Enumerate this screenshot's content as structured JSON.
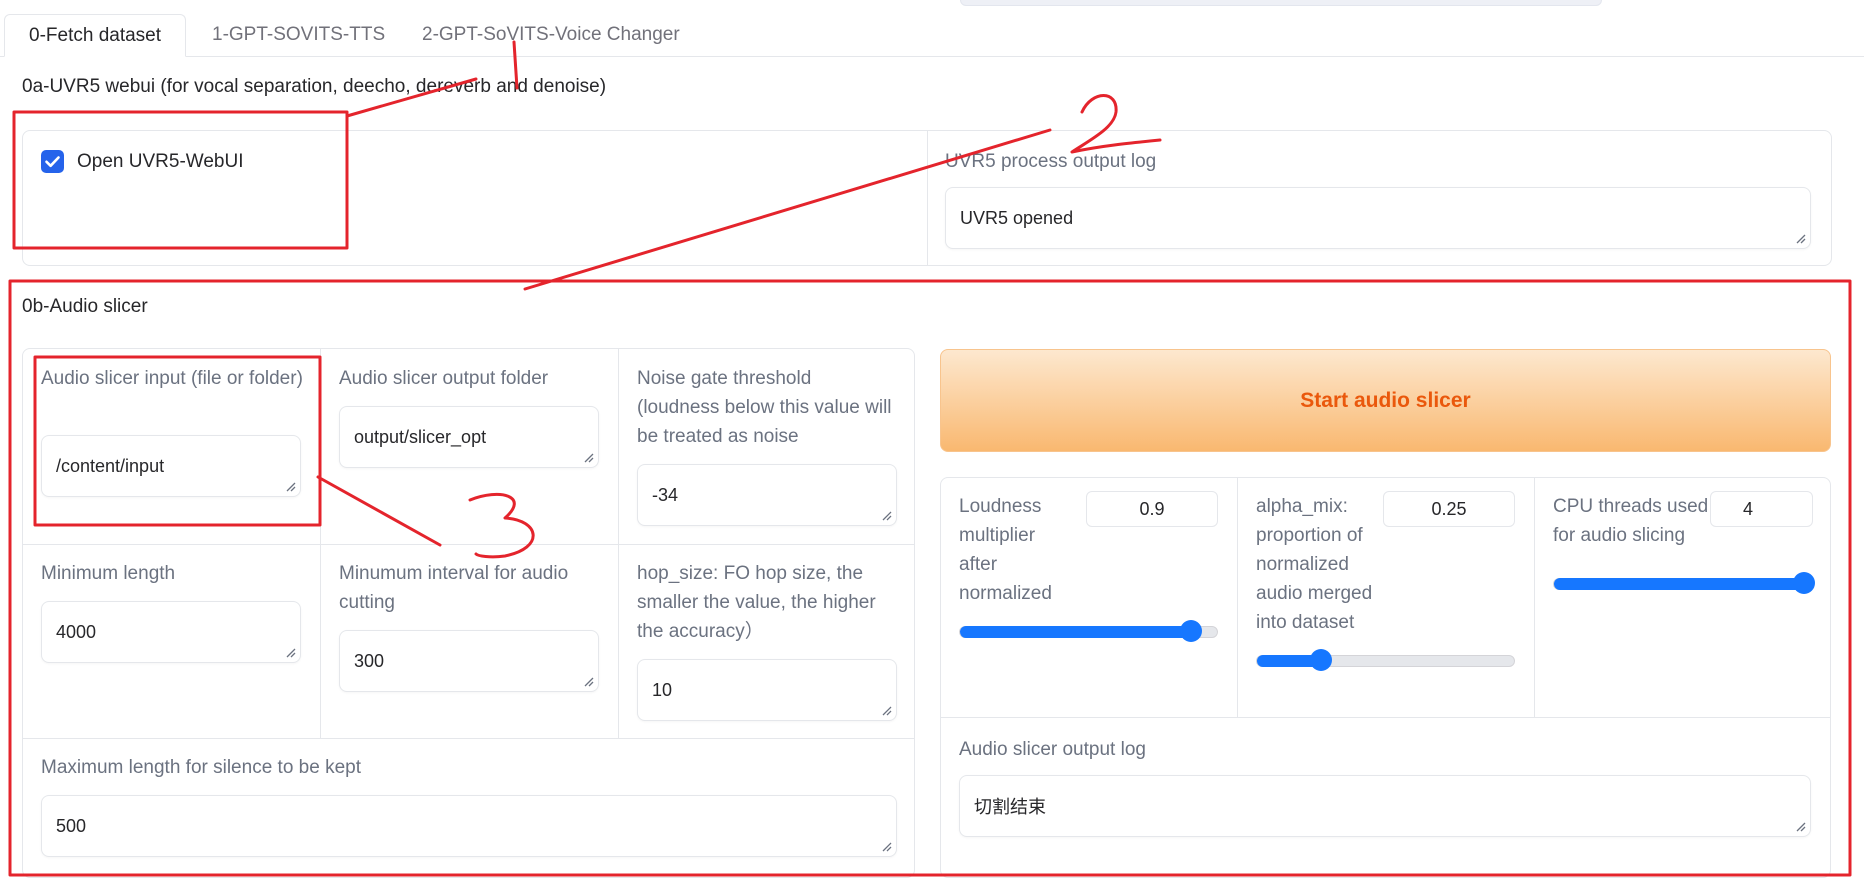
{
  "tabs": [
    {
      "label": "0-Fetch dataset",
      "active": true
    },
    {
      "label": "1-GPT-SOVITS-TTS",
      "active": false
    },
    {
      "label": "2-GPT-SoVITS-Voice Changer",
      "active": false
    }
  ],
  "uvr5": {
    "title": "0a-UVR5 webui (for vocal separation, deecho, dereverb and denoise)",
    "checkbox_label": "Open UVR5-WebUI",
    "checked": true,
    "log_label": "UVR5 process output log",
    "log_value": "UVR5 opened"
  },
  "slicer": {
    "title": "0b-Audio slicer",
    "input_label": "Audio slicer input (file or folder)",
    "input_value": "/content/input",
    "output_label": "Audio slicer output folder",
    "output_value": "output/slicer_opt",
    "threshold_label": "Noise gate threshold (loudness below this value will be treated as noise",
    "threshold_value": "-34",
    "min_length_label": "Minimum length",
    "min_length_value": "4000",
    "min_interval_label": "Minumum interval for audio cutting",
    "min_interval_value": "300",
    "hop_size_label": "hop_size: FO hop size, the smaller the value, the higher the accuracy）",
    "hop_size_value": "10",
    "max_sil_label": "Maximum length for silence to be kept",
    "max_sil_value": "500",
    "start_button": "Start audio slicer",
    "loudness_label": "Loudness multiplier after normalized",
    "loudness_value": "0.9",
    "loudness_fraction": 0.9,
    "alpha_label": "alpha_mix: proportion of normalized audio merged into dataset",
    "alpha_value": "0.25",
    "alpha_fraction": 0.25,
    "threads_label": "CPU threads used for audio slicing",
    "threads_value": "4",
    "threads_fraction": 1.0,
    "log_label": "Audio slicer output log",
    "log_value": "切割结束"
  },
  "annotations": {
    "marks": [
      "1",
      "2",
      "3"
    ],
    "color": "#e4242c"
  },
  "colors": {
    "accent": "#2563eb",
    "slider": "#1677ff",
    "button_text": "#ea580c"
  }
}
